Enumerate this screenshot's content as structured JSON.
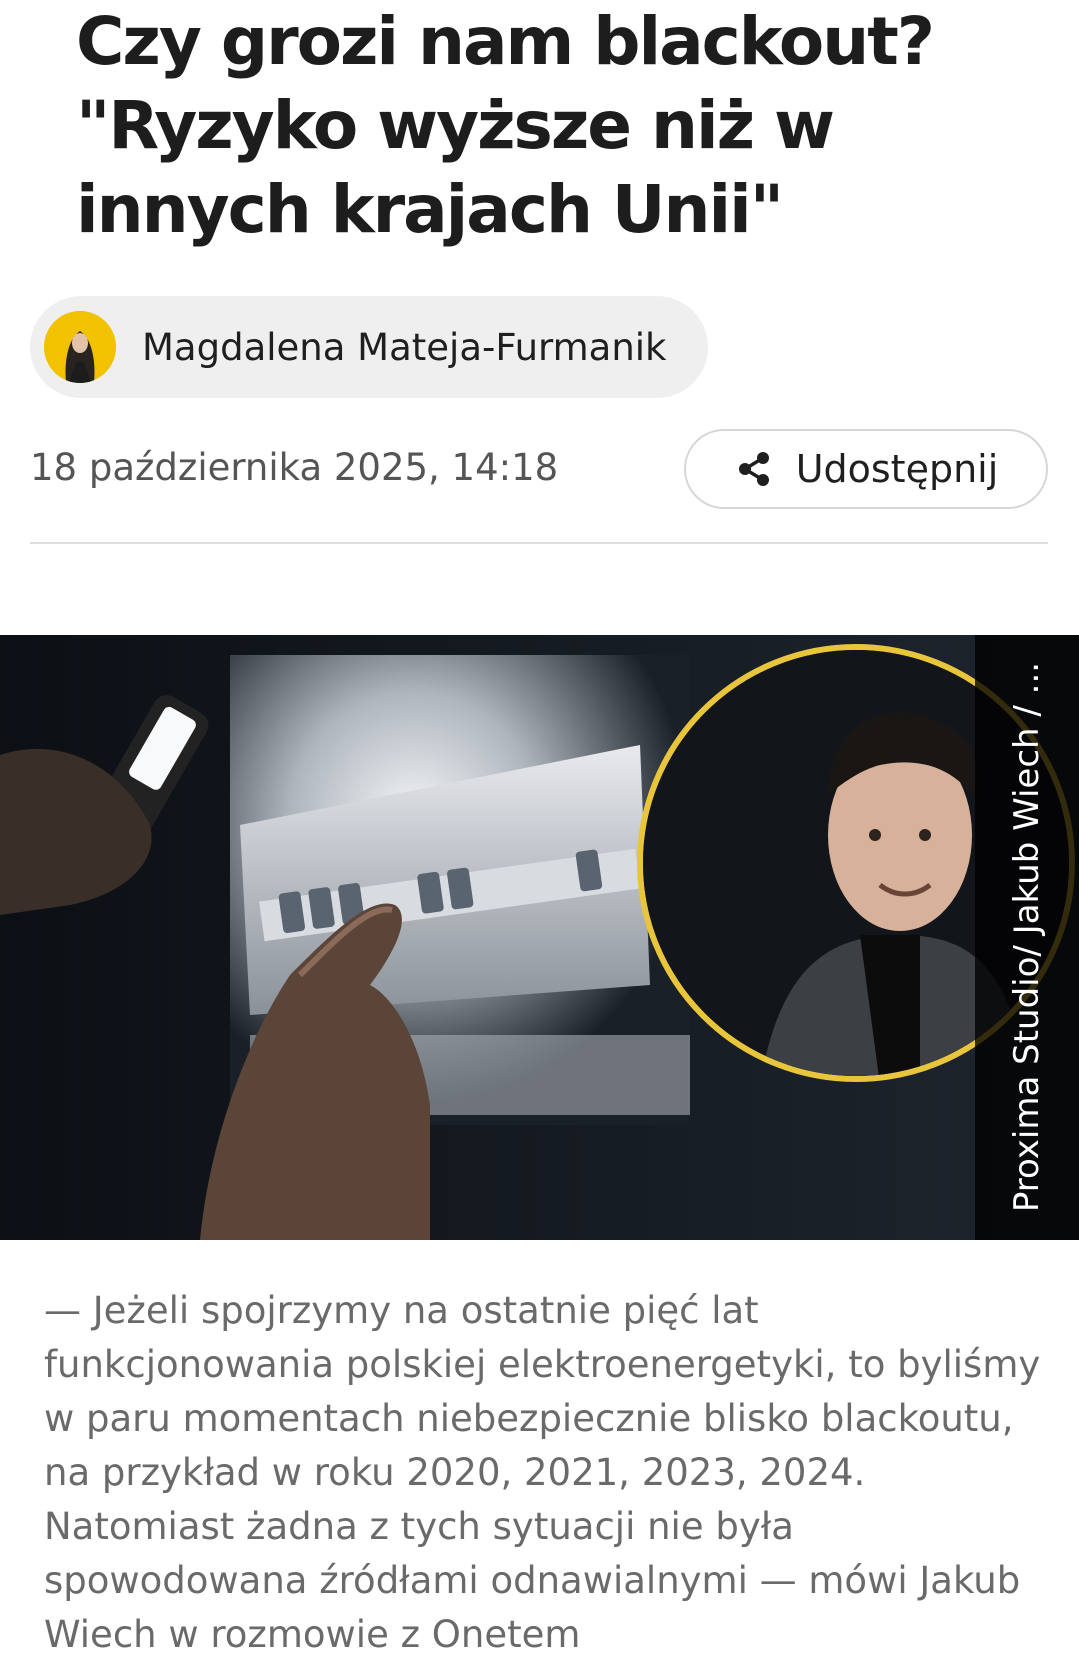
{
  "article": {
    "title": "Czy grozi nam blackout? \"Ryzyko wyższe niż w innych krajach Unii\"",
    "author": {
      "name": "Magdalena Mateja-Furmanik",
      "avatar_icon": "author-avatar"
    },
    "date": "18 października 2025, 14:18",
    "share": {
      "label": "Udostępnij",
      "icon": "share-icon"
    },
    "image": {
      "credit": "Proxima Studio/ Jakub Wiech / ..."
    },
    "lead": "— Jeżeli spojrzymy na ostatnie pięć lat funkcjonowania polskiej elektroenergetyki, to byliśmy w paru momentach niebezpiecznie blisko blackoutu, na przykład w roku 2020, 2021, 2023, 2024. Natomiast żadna z tych sytuacji nie była spowodowana źródłami odnawialnymi — mówi Jakub Wiech w rozmowie z Onetem"
  },
  "colors": {
    "accent": "#f2c200",
    "text": "#1f1f1f",
    "muted": "#6a6a6a",
    "chip_bg": "#efefef"
  }
}
